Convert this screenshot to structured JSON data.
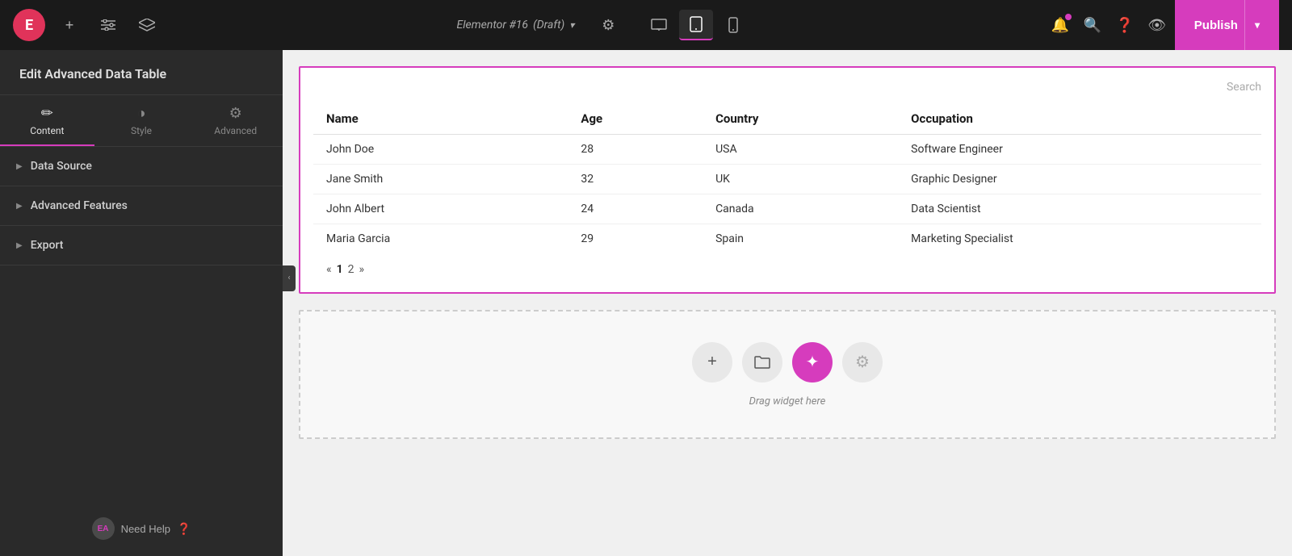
{
  "topbar": {
    "logo_text": "E",
    "add_label": "+",
    "draft_title": "Elementor #16",
    "draft_status": "(Draft)",
    "publish_label": "Publish",
    "view_modes": [
      "desktop",
      "tablet",
      "mobile"
    ],
    "active_view": "tablet"
  },
  "sidebar": {
    "title": "Edit Advanced Data Table",
    "tabs": [
      {
        "id": "content",
        "label": "Content",
        "icon": "✏️"
      },
      {
        "id": "style",
        "label": "Style",
        "icon": "◑"
      },
      {
        "id": "advanced",
        "label": "Advanced",
        "icon": "⚙️"
      }
    ],
    "active_tab": "content",
    "sections": [
      {
        "id": "data-source",
        "label": "Data Source"
      },
      {
        "id": "advanced-features",
        "label": "Advanced Features"
      },
      {
        "id": "export",
        "label": "Export"
      }
    ],
    "need_help_label": "Need Help",
    "ea_badge": "EA"
  },
  "table": {
    "search_placeholder": "Search",
    "columns": [
      "Name",
      "Age",
      "Country",
      "Occupation"
    ],
    "rows": [
      {
        "name": "John Doe",
        "age": "28",
        "country": "USA",
        "occupation": "Software Engineer"
      },
      {
        "name": "Jane Smith",
        "age": "32",
        "country": "UK",
        "occupation": "Graphic Designer"
      },
      {
        "name": "John Albert",
        "age": "24",
        "country": "Canada",
        "occupation": "Data Scientist"
      },
      {
        "name": "Maria Garcia",
        "age": "29",
        "country": "Spain",
        "occupation": "Marketing Specialist"
      }
    ],
    "pagination": [
      "«",
      "1",
      "2",
      "»"
    ]
  },
  "drop_zone": {
    "label": "Drag widget here",
    "buttons": [
      {
        "id": "add",
        "icon": "+",
        "style": "light"
      },
      {
        "id": "folder",
        "icon": "📁",
        "style": "light"
      },
      {
        "id": "magic",
        "icon": "✦",
        "style": "pink"
      },
      {
        "id": "ai",
        "icon": "⚙",
        "style": "disabled"
      }
    ]
  },
  "colors": {
    "accent": "#d63cbd",
    "topbar_bg": "#1a1a1a",
    "sidebar_bg": "#2a2a2a"
  }
}
